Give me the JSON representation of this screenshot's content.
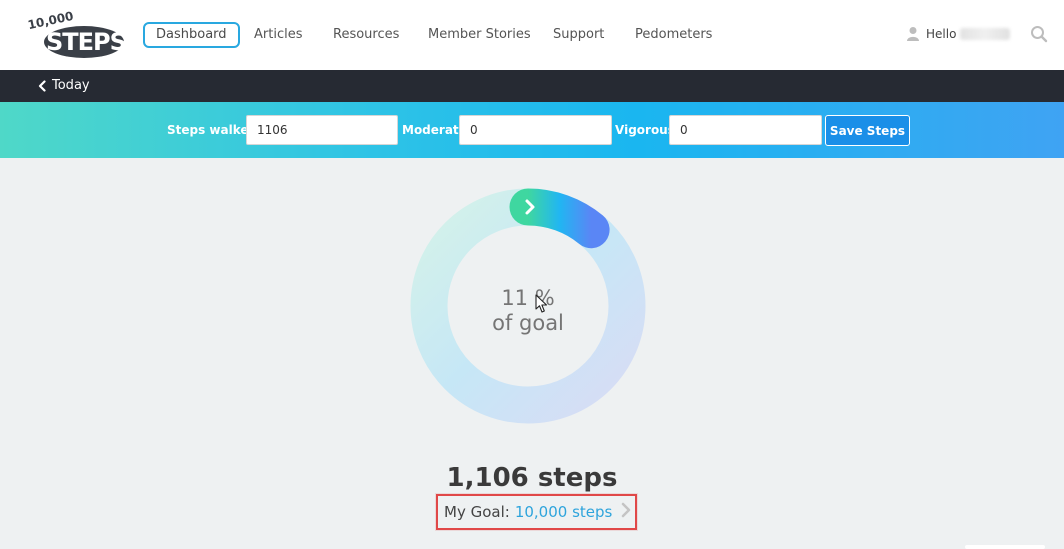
{
  "logo": {
    "text_top": "10,000",
    "text_main": "STEPS"
  },
  "nav": {
    "items": [
      {
        "label": "Dashboard",
        "active": true
      },
      {
        "label": "Articles"
      },
      {
        "label": "Resources"
      },
      {
        "label": "Member Stories"
      },
      {
        "label": "Support"
      },
      {
        "label": "Pedometers"
      }
    ],
    "greeting": "Hello"
  },
  "subnav": {
    "back_label": "Today"
  },
  "log_form": {
    "steps_label": "Steps walked",
    "steps_value": "1106",
    "moderate_label": "Moderate",
    "moderate_value": "0",
    "vigorous_label": "Vigorous",
    "vigorous_value": "0",
    "save_label": "Save Steps"
  },
  "progress": {
    "percent_text": "11 %",
    "caption": "of goal",
    "fraction": 0.11
  },
  "summary": {
    "steps_text": "1,106 steps",
    "goal_label": "My Goal:",
    "goal_value": "10,000 steps"
  },
  "colors": {
    "accent": "#29a8e0",
    "highlight_box": "#e04848",
    "dark_bar": "#262a33"
  }
}
